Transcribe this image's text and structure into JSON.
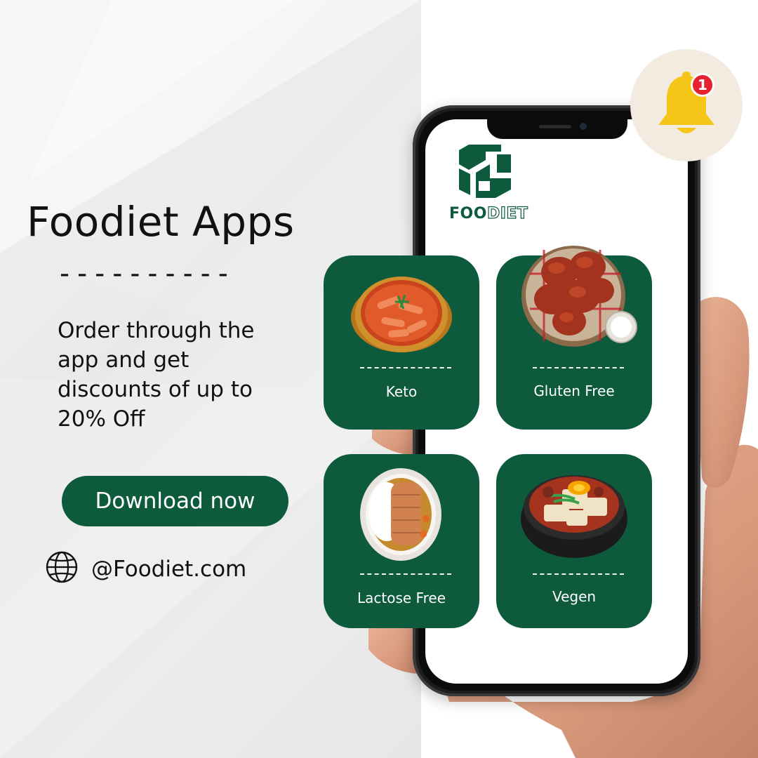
{
  "hero": {
    "title": "Foodiet Apps",
    "title_underline": "----------",
    "promo_text": "Order through the app and get discounts of up to 20% Off",
    "download_label": "Download now",
    "website": "@Foodiet.com"
  },
  "brand": {
    "logo_icon": "foodiet-logo-icon",
    "name_part1": "FOO",
    "name_part2": "DIET",
    "color": "#0d5a3d"
  },
  "notification": {
    "icon": "bell-icon",
    "count": "1",
    "badge_color": "#e5202f",
    "bell_color": "#f5c518"
  },
  "categories": [
    {
      "label": "Keto",
      "icon": "tteokbokki-pot-icon"
    },
    {
      "label": "Gluten Free",
      "icon": "fried-chicken-icon"
    },
    {
      "label": "Lactose Free",
      "icon": "katsu-curry-icon"
    },
    {
      "label": "Vegen",
      "icon": "tofu-stew-icon"
    }
  ]
}
